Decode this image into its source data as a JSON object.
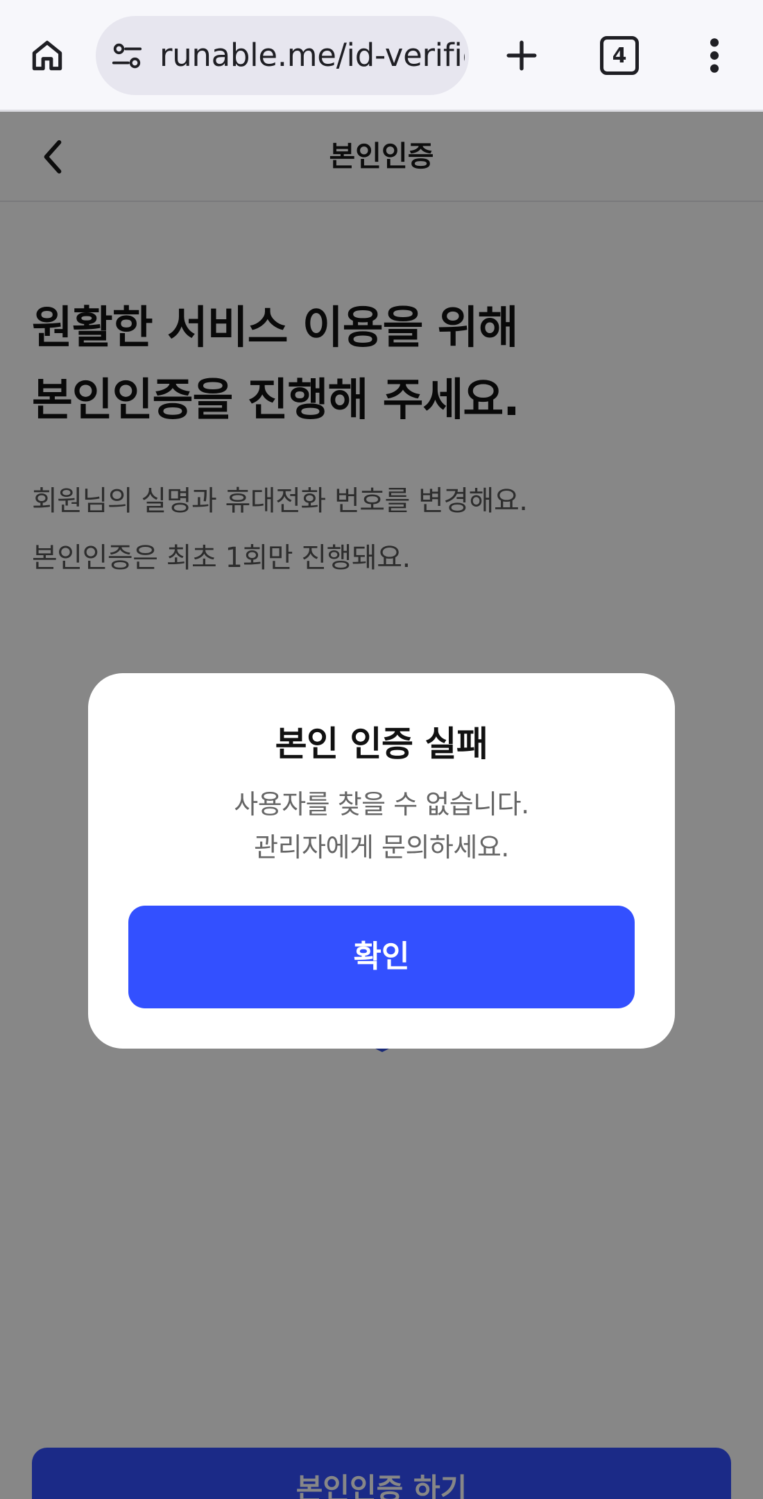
{
  "browser": {
    "url": "runable.me/id-verific",
    "tab_count": "4"
  },
  "header": {
    "title": "본인인증"
  },
  "hero": {
    "title_lines": [
      "원활한 서비스 이용을 위해",
      "본인인증을 진행해 주세요."
    ],
    "desc_lines": [
      "회원님의 실명과 휴대전화 번호를 변경해요.",
      "본인인증은 최초 1회만 진행돼요."
    ]
  },
  "cta": {
    "label": "본인인증 하기"
  },
  "modal": {
    "title": "본인 인증 실패",
    "message_lines": [
      "사용자를 찾을 수 없습니다.",
      "관리자에게 문의하세요."
    ],
    "confirm_label": "확인"
  },
  "colors": {
    "primary": "#3350ff",
    "shield_dark": "#0b2aa8",
    "overlay": "rgba(0,0,0,0.47)"
  },
  "icons": {
    "home": "home-icon",
    "site_settings": "tune-icon",
    "new_tab": "plus-icon",
    "tabs": "tab-switcher-icon",
    "menu": "more-vert-icon",
    "back": "chevron-left-icon",
    "shield": "shield-sparkle-icon"
  }
}
